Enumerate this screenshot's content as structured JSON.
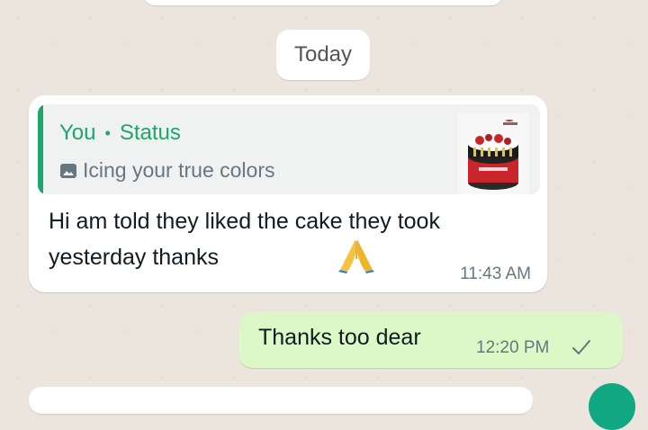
{
  "date_divider": "Today",
  "incoming_message": {
    "reply": {
      "author": "You",
      "source": "Status",
      "separator": "•",
      "caption": "Icing your true colors",
      "thumbnail_icon": "cake-thumbnail"
    },
    "text": "Hi am told they liked the cake they took yesterday thanks",
    "emoji": "folded-hands-emoji",
    "time": "11:43 AM"
  },
  "outgoing_message": {
    "text": "Thanks too dear",
    "time": "12:20 PM",
    "status_icon": "single-check-icon"
  },
  "colors": {
    "chat_background": "#ece5dd",
    "incoming_bubble": "#ffffff",
    "outgoing_bubble": "#dcf8c6",
    "accent_green": "#1ca76b",
    "meta_text": "#667781"
  }
}
